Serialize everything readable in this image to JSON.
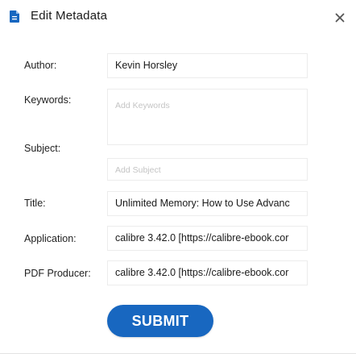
{
  "dialog": {
    "title": "Edit Metadata",
    "icons": {
      "document": "document-icon",
      "close": "close-icon"
    },
    "accent_color": "#1867c0"
  },
  "fields": {
    "author": {
      "label": "Author:",
      "value": "Kevin Horsley"
    },
    "keywords": {
      "label": "Keywords:",
      "placeholder": "Add Keywords"
    },
    "subject": {
      "label": "Subject:",
      "placeholder": "Add Subject"
    },
    "title": {
      "label": "Title:",
      "value": "Unlimited Memory: How to Use Advanc"
    },
    "application": {
      "label": "Application:",
      "value": "calibre 3.42.0 [https://calibre-ebook.cor"
    },
    "pdf_producer": {
      "label": "PDF Producer:",
      "value": "calibre 3.42.0 [https://calibre-ebook.cor"
    }
  },
  "submit_label": "SUBMIT"
}
